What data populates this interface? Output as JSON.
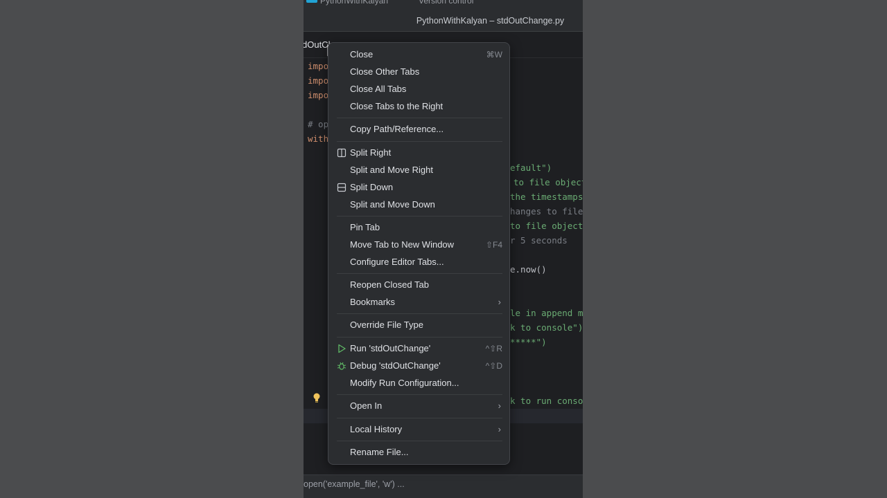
{
  "ide": {
    "project_name": "PythonWithKalyan",
    "version_control": "Version control",
    "window_title": "PythonWithKalyan – stdOutChange.py",
    "tab_label": "dOutCh",
    "status_text": "open('example_file', 'w') ..."
  },
  "code": {
    "l1": "impo",
    "l2": "impo",
    "l3": "impo",
    "l4": "# op",
    "l5": "with",
    "r1": "efault\")",
    "r2": "to file object",
    "r3": "the timestamps",
    "r4": "hanges to file",
    "r5": "to file object",
    "r6": "r 5 seconds",
    "r7": "e.now()",
    "r8": "le in append mo",
    "r9": "k to console\")",
    "r10": "*****\")",
    "r11": "k to run consol"
  },
  "menu": {
    "close": "Close",
    "close_shortcut": "⌘W",
    "close_other": "Close Other Tabs",
    "close_all": "Close All Tabs",
    "close_right": "Close Tabs to the Right",
    "copy_path": "Copy Path/Reference...",
    "split_right": "Split Right",
    "split_move_right": "Split and Move Right",
    "split_down": "Split Down",
    "split_move_down": "Split and Move Down",
    "pin_tab": "Pin Tab",
    "move_tab": "Move Tab to New Window",
    "move_tab_shortcut": "⇧F4",
    "configure_tabs": "Configure Editor Tabs...",
    "reopen": "Reopen Closed Tab",
    "bookmarks": "Bookmarks",
    "override": "Override File Type",
    "run": "Run 'stdOutChange'",
    "run_shortcut": "^⇧R",
    "debug": "Debug 'stdOutChange'",
    "debug_shortcut": "^⇧D",
    "modify_run": "Modify Run Configuration...",
    "open_in": "Open In",
    "local_history": "Local History",
    "rename": "Rename File..."
  },
  "icons": {
    "split_right": "split-vertical-icon",
    "split_down": "split-horizontal-icon",
    "run": "run-play-icon",
    "debug": "debug-bug-icon",
    "submenu": "chevron-right-icon",
    "bulb": "lightbulb-icon",
    "cursor": "mouse-pointer-icon"
  },
  "colors": {
    "run_green": "#5fb865",
    "bulb_yellow": "#f2c55c",
    "keyword": "#cf8e6d",
    "string": "#6aab73",
    "comment": "#7a7e85"
  }
}
